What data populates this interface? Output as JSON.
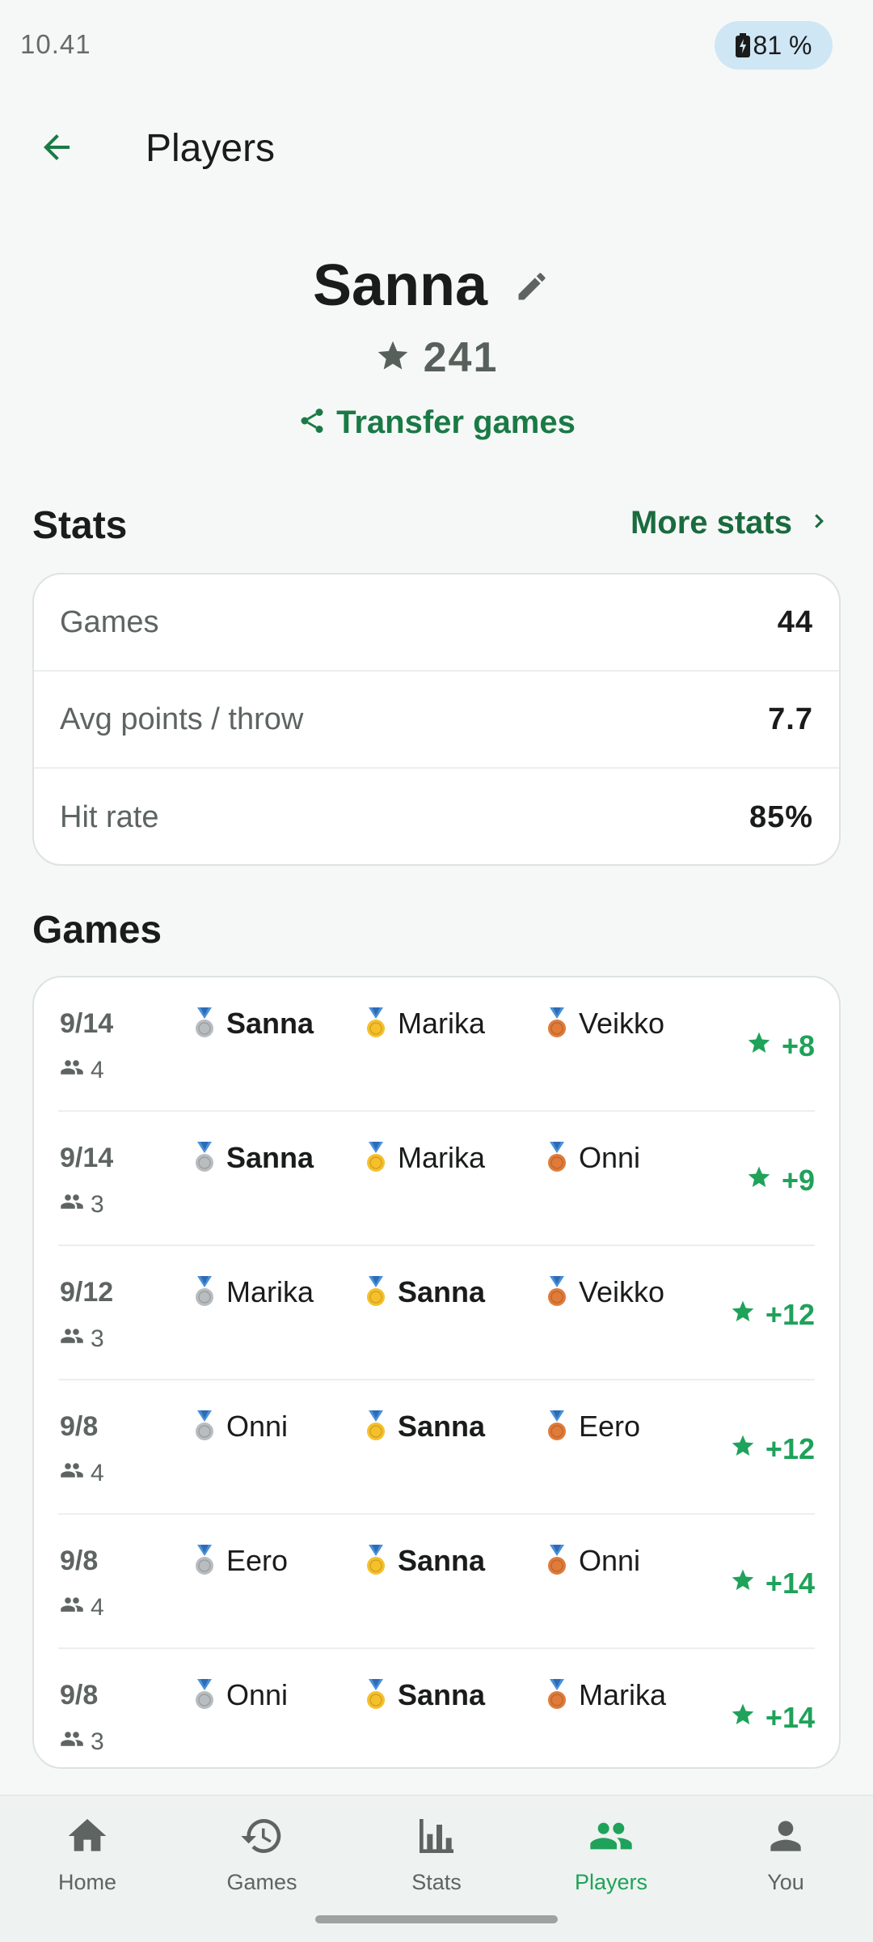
{
  "status_bar": {
    "time": "10.41",
    "battery": "81 %"
  },
  "top_bar": {
    "title": "Players"
  },
  "profile": {
    "name": "Sanna",
    "rating": "241",
    "transfer_label": "Transfer games"
  },
  "stats_section": {
    "title": "Stats",
    "more_label": "More stats",
    "rows": [
      {
        "label": "Games",
        "value": "44"
      },
      {
        "label": "Avg points / throw",
        "value": "7.7"
      },
      {
        "label": "Hit rate",
        "value": "85%"
      }
    ]
  },
  "games_section": {
    "title": "Games",
    "games": [
      {
        "date": "9/14",
        "players_count": "4",
        "placements": [
          {
            "name": "Sanna",
            "medal": "silver",
            "is_self": true
          },
          {
            "name": "Marika",
            "medal": "gold",
            "is_self": false
          },
          {
            "name": "Veikko",
            "medal": "bronze",
            "is_self": false
          }
        ],
        "delta": "+8"
      },
      {
        "date": "9/14",
        "players_count": "3",
        "placements": [
          {
            "name": "Sanna",
            "medal": "silver",
            "is_self": true
          },
          {
            "name": "Marika",
            "medal": "gold",
            "is_self": false
          },
          {
            "name": "Onni",
            "medal": "bronze",
            "is_self": false
          }
        ],
        "delta": "+9"
      },
      {
        "date": "9/12",
        "players_count": "3",
        "placements": [
          {
            "name": "Marika",
            "medal": "silver",
            "is_self": false
          },
          {
            "name": "Sanna",
            "medal": "gold",
            "is_self": true
          },
          {
            "name": "Veikko",
            "medal": "bronze",
            "is_self": false
          }
        ],
        "delta": "+12"
      },
      {
        "date": "9/8",
        "players_count": "4",
        "placements": [
          {
            "name": "Onni",
            "medal": "silver",
            "is_self": false
          },
          {
            "name": "Sanna",
            "medal": "gold",
            "is_self": true
          },
          {
            "name": "Eero",
            "medal": "bronze",
            "is_self": false
          }
        ],
        "delta": "+12"
      },
      {
        "date": "9/8",
        "players_count": "4",
        "placements": [
          {
            "name": "Eero",
            "medal": "silver",
            "is_self": false
          },
          {
            "name": "Sanna",
            "medal": "gold",
            "is_self": true
          },
          {
            "name": "Onni",
            "medal": "bronze",
            "is_self": false
          }
        ],
        "delta": "+14"
      },
      {
        "date": "9/8",
        "players_count": "3",
        "placements": [
          {
            "name": "Onni",
            "medal": "silver",
            "is_self": false
          },
          {
            "name": "Sanna",
            "medal": "gold",
            "is_self": true
          },
          {
            "name": "Marika",
            "medal": "bronze",
            "is_self": false
          }
        ],
        "delta": "+14"
      }
    ]
  },
  "bottom_nav": {
    "items": [
      {
        "label": "Home",
        "icon": "home-icon",
        "active": false
      },
      {
        "label": "Games",
        "icon": "history-icon",
        "active": false
      },
      {
        "label": "Stats",
        "icon": "bar-chart-icon",
        "active": false
      },
      {
        "label": "Players",
        "icon": "group-icon",
        "active": true
      },
      {
        "label": "You",
        "icon": "person-icon",
        "active": false
      }
    ]
  },
  "colors": {
    "accent_green": "#1a7a46",
    "positive_delta": "#1fa25a",
    "gold": "#f6c02a",
    "silver": "#b9bdc0",
    "bronze": "#e07b39"
  }
}
